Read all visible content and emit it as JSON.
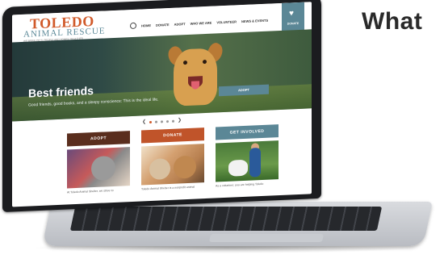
{
  "page": {
    "heading": "What"
  },
  "site": {
    "logo_top": "TOLEDO",
    "logo_bottom": "ANIMAL RESCUE",
    "tagline": "WE BRING PETS, PEOPLE AND HOMES TOGETHER",
    "nav": [
      "HOME",
      "DONATE",
      "ADOPT",
      "WHO WE ARE",
      "VOLUNTEER",
      "NEWS & EVENTS"
    ],
    "donate_tab": "DONATE"
  },
  "hero": {
    "title": "Best friends",
    "subtitle": "Good friends, good books, and a sleepy conscience: This is the ideal life.",
    "button": "ADOPT"
  },
  "carousel": {
    "prev": "❮",
    "next": "❯",
    "dots": 5,
    "active": 0
  },
  "cards": [
    {
      "title": "ADOPT",
      "text": "At Toledo Animal Shelter, we strive to"
    },
    {
      "title": "DONATE",
      "text": "Toledo Animal Shelter is a nonprofit animal"
    },
    {
      "title": "GET INVOLVED",
      "text": "As a volunteer, you are helping Toledo"
    }
  ],
  "colors": {
    "orange": "#d15a2a",
    "teal": "#5b8796",
    "brown": "#5a2e1e"
  }
}
